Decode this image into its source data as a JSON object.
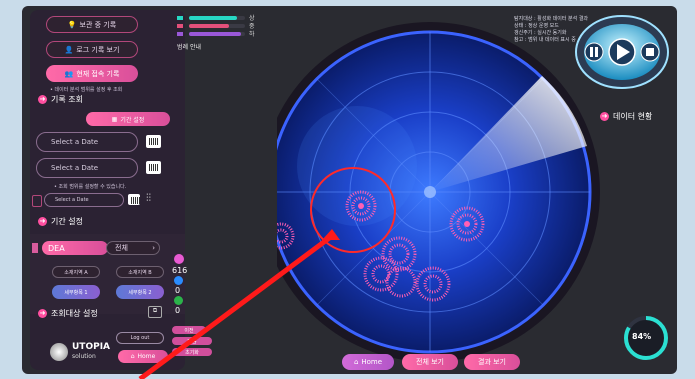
{
  "sidebar": {
    "top_buttons": [
      {
        "label": "보관 중 기록",
        "icon": "bulb-icon"
      },
      {
        "label": "로그 기록 보기",
        "icon": "user-icon"
      },
      {
        "label": "현재 접속 기록",
        "icon": "people-icon"
      }
    ],
    "top_note": "• 데이터 분석 범위를 설정 후 조회",
    "section_log": "기록 조회",
    "period_button": "기간 설정",
    "date_placeholder_1": "Select a Date",
    "date_placeholder_2": "Select a Date",
    "date_note": "• 조회 범위를 설정할 수 있습니다.",
    "date_small": "Select a Date",
    "section_period": "기간 설정",
    "device_label": "DEA",
    "device_select": "전체",
    "subs": [
      "소재지역 A",
      "소재지역 B"
    ],
    "subs2": [
      "세부항목 1",
      "세부항목 2"
    ],
    "section_target": "조회대상 설정",
    "logo_name": "UTOPIA",
    "logo_sub": "solution",
    "logout_label": "Log out",
    "home_label": "Home"
  },
  "legend": {
    "caption": "범례 안내",
    "rows": [
      {
        "label": "상",
        "color": "#27d8c4",
        "fill": 0.85
      },
      {
        "label": "중",
        "color": "#e3507a",
        "fill": 0.7
      },
      {
        "label": "하",
        "color": "#9a58d8",
        "fill": 0.9
      }
    ]
  },
  "info_text": "탐지대상 : 활성화 데이터 분석 결과\n상태 : 정상 운영 모드\n갱신주기 : 실시간 동기화\n참고 : 범위 내 데이터 표시 중",
  "side_label": "데이터 현황",
  "counters": [
    "616",
    "0",
    "0"
  ],
  "dial_value": "84%",
  "bottom_buttons": [
    {
      "label": "Home",
      "style": "violet"
    },
    {
      "label": "전체 보기",
      "style": "filled"
    },
    {
      "label": "결과 보기",
      "style": "filled"
    }
  ],
  "mini_buttons": [
    "이전",
    "다음",
    "초기화"
  ],
  "accent": "#ff4fa0",
  "radar_color": "#2a5bff"
}
